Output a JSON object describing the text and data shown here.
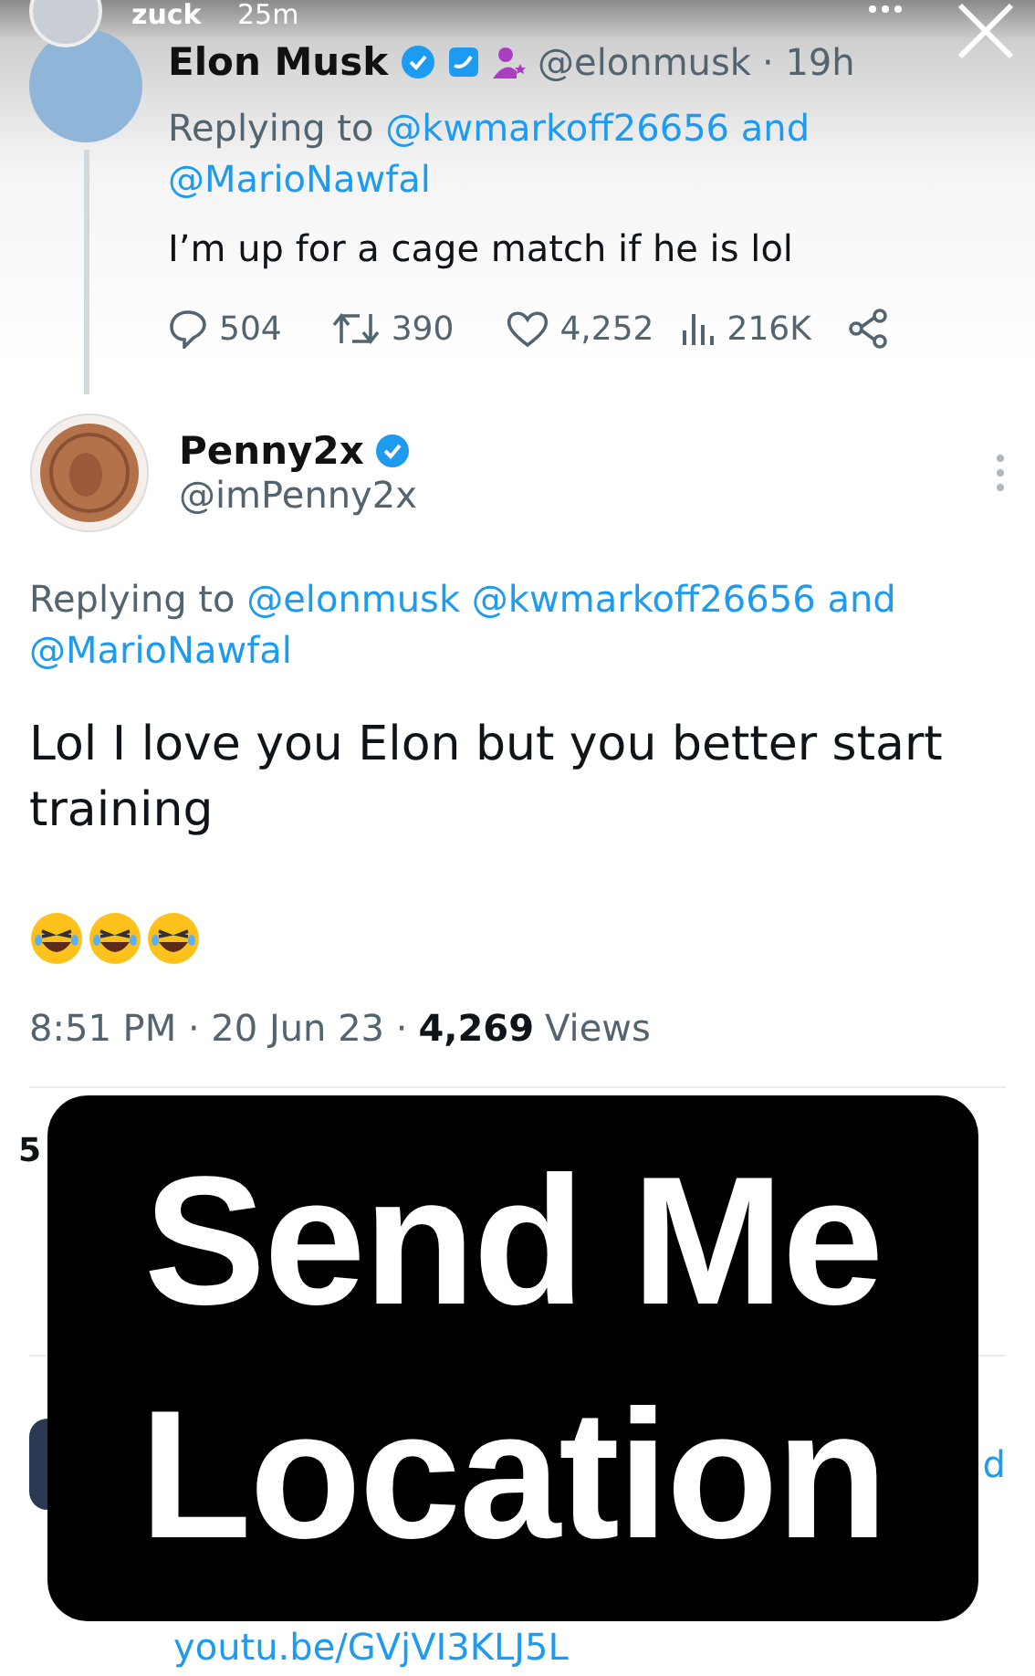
{
  "story_header": {
    "username": "zuck",
    "time": "25m"
  },
  "reply_tweet": {
    "name": "Elon Musk",
    "handle": "@elonmusk",
    "time": "· 19h",
    "replying_prefix": "Replying to",
    "replying_to": [
      "@kwmarkoff26656",
      "@MarioNawfal"
    ],
    "joiner": "and",
    "text": "I’m up for a cage match if he is lol",
    "stats": {
      "replies": "504",
      "retweets": "390",
      "likes": "4,252",
      "views": "216K"
    }
  },
  "main_tweet": {
    "name": "Penny2x",
    "handle": "@imPenny2x",
    "replying_prefix": "Replying to",
    "replying_to": [
      "@elonmusk",
      "@kwmarkoff26656",
      "@MarioNawfal"
    ],
    "joiner": "and",
    "text": "Lol I love you Elon but you better start training",
    "emojis": [
      {
        "kind": "laughing"
      },
      {
        "kind": "laughing"
      },
      {
        "kind": "laughing"
      }
    ],
    "time": "8:51 PM · 20 Jun 23 ·",
    "views_count": "4,269",
    "views_label": "Views"
  },
  "hidden_row": {
    "partial_count": "5"
  },
  "next_reply": {
    "partial_text": "d",
    "link": "youtu.be/GVjVI3KLJ5L"
  },
  "sticker": {
    "lines": [
      "Send Me",
      "Location"
    ]
  }
}
